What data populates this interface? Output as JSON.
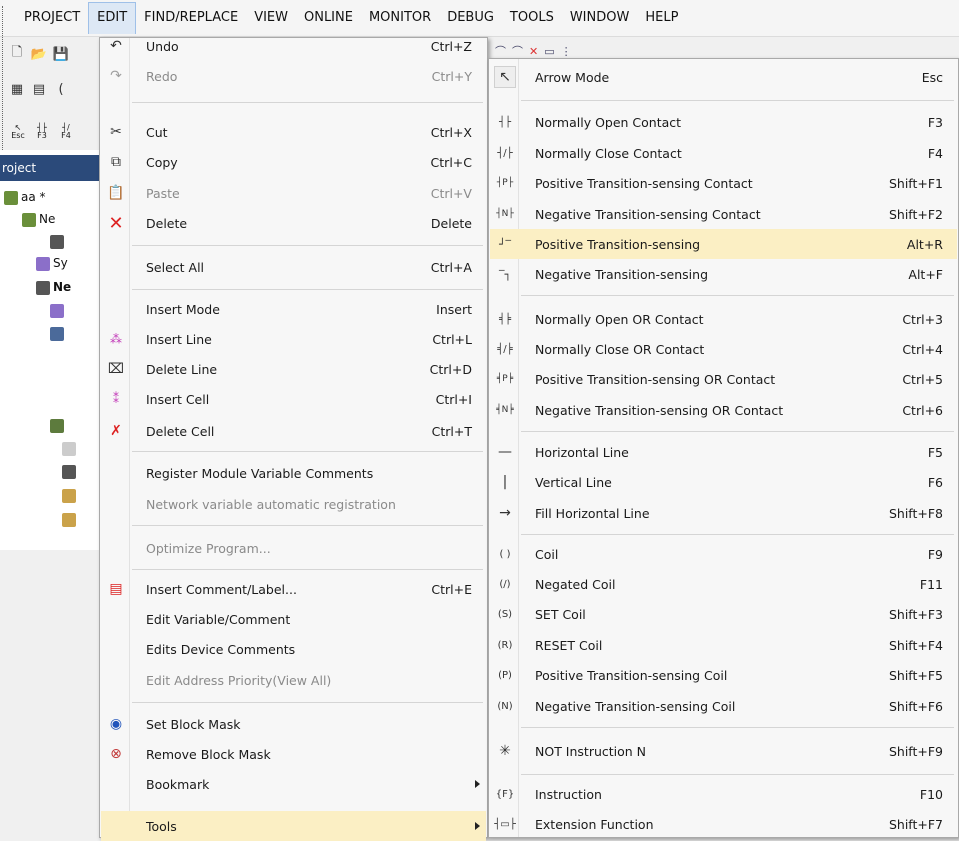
{
  "menubar": {
    "items": [
      "PROJECT",
      "EDIT",
      "FIND/REPLACE",
      "VIEW",
      "ONLINE",
      "MONITOR",
      "DEBUG",
      "TOOLS",
      "WINDOW",
      "HELP"
    ]
  },
  "toolbar": {
    "shortcut_labels": [
      "Esc",
      "F3",
      "F4"
    ]
  },
  "project_panel": {
    "title": "roject",
    "tree": [
      "aa *",
      "Ne",
      "Sy",
      "Ne"
    ]
  },
  "edit_menu": {
    "items": [
      {
        "label": "Undo",
        "shortcut": "Ctrl+Z",
        "icon": "undo-icon"
      },
      {
        "label": "Redo",
        "shortcut": "Ctrl+Y",
        "icon": "redo-icon"
      },
      {
        "label": "Cut",
        "shortcut": "Ctrl+X",
        "icon": "scissors-icon"
      },
      {
        "label": "Copy",
        "shortcut": "Ctrl+C",
        "icon": "copy-icon"
      },
      {
        "label": "Paste",
        "shortcut": "Ctrl+V",
        "icon": "paste-icon"
      },
      {
        "label": "Delete",
        "shortcut": "Delete",
        "icon": "delete-x-icon"
      },
      {
        "label": "Select All",
        "shortcut": "Ctrl+A"
      },
      {
        "label": "Insert Mode",
        "shortcut": "Insert"
      },
      {
        "label": "Insert Line",
        "shortcut": "Ctrl+L",
        "icon": "insert-line-icon"
      },
      {
        "label": "Delete Line",
        "shortcut": "Ctrl+D",
        "icon": "delete-line-icon"
      },
      {
        "label": "Insert Cell",
        "shortcut": "Ctrl+I",
        "icon": "insert-cell-icon"
      },
      {
        "label": "Delete Cell",
        "shortcut": "Ctrl+T",
        "icon": "delete-cell-icon"
      },
      {
        "label": "Register Module Variable Comments",
        "shortcut": ""
      },
      {
        "label": "Network variable automatic registration",
        "shortcut": ""
      },
      {
        "label": "Optimize Program...",
        "shortcut": ""
      },
      {
        "label": "Insert Comment/Label...",
        "shortcut": "Ctrl+E",
        "icon": "comment-icon"
      },
      {
        "label": "Edit Variable/Comment",
        "shortcut": ""
      },
      {
        "label": "Edits Device Comments",
        "shortcut": ""
      },
      {
        "label": "Edit Address Priority(View All)",
        "shortcut": ""
      },
      {
        "label": "Set Block Mask",
        "shortcut": "",
        "icon": "set-mask-icon"
      },
      {
        "label": "Remove Block Mask",
        "shortcut": "",
        "icon": "remove-mask-icon"
      },
      {
        "label": "Bookmark",
        "shortcut": ""
      },
      {
        "label": "Tools",
        "shortcut": ""
      }
    ]
  },
  "tools_menu": {
    "items": [
      {
        "label": "Arrow Mode",
        "shortcut": "Esc",
        "glyph": "↖"
      },
      {
        "label": "Normally Open Contact",
        "shortcut": "F3",
        "glyph": "┤├"
      },
      {
        "label": "Normally Close Contact",
        "shortcut": "F4",
        "glyph": "┤/├"
      },
      {
        "label": "Positive Transition-sensing Contact",
        "shortcut": "Shift+F1",
        "glyph": "┤P├"
      },
      {
        "label": "Negative Transition-sensing Contact",
        "shortcut": "Shift+F2",
        "glyph": "┤N├"
      },
      {
        "label": "Positive Transition-sensing",
        "shortcut": "Alt+R",
        "glyph": "┘‾"
      },
      {
        "label": "Negative Transition-sensing",
        "shortcut": "Alt+F",
        "glyph": "‾┐"
      },
      {
        "label": "Normally Open OR Contact",
        "shortcut": "Ctrl+3",
        "glyph": "╡╞"
      },
      {
        "label": "Normally Close OR Contact",
        "shortcut": "Ctrl+4",
        "glyph": "╡/╞"
      },
      {
        "label": "Positive Transition-sensing OR Contact",
        "shortcut": "Ctrl+5",
        "glyph": "╡P╞"
      },
      {
        "label": "Negative Transition-sensing OR Contact",
        "shortcut": "Ctrl+6",
        "glyph": "╡N╞"
      },
      {
        "label": "Horizontal Line",
        "shortcut": "F5",
        "glyph": "—"
      },
      {
        "label": "Vertical Line",
        "shortcut": "F6",
        "glyph": "|"
      },
      {
        "label": "Fill Horizontal Line",
        "shortcut": "Shift+F8",
        "glyph": "→"
      },
      {
        "label": "Coil",
        "shortcut": "F9",
        "glyph": "( )"
      },
      {
        "label": "Negated Coil",
        "shortcut": "F11",
        "glyph": "(/)"
      },
      {
        "label": "SET Coil",
        "shortcut": "Shift+F3",
        "glyph": "(S)"
      },
      {
        "label": "RESET Coil",
        "shortcut": "Shift+F4",
        "glyph": "(R)"
      },
      {
        "label": "Positive Transition-sensing Coil",
        "shortcut": "Shift+F5",
        "glyph": "(P)"
      },
      {
        "label": "Negative Transition-sensing Coil",
        "shortcut": "Shift+F6",
        "glyph": "(N)"
      },
      {
        "label": "NOT Instruction N",
        "shortcut": "Shift+F9",
        "glyph": "✳"
      },
      {
        "label": "Instruction",
        "shortcut": "F10",
        "glyph": "{F}"
      },
      {
        "label": "Extension Function",
        "shortcut": "Shift+F7",
        "glyph": "┤▭├"
      }
    ]
  }
}
